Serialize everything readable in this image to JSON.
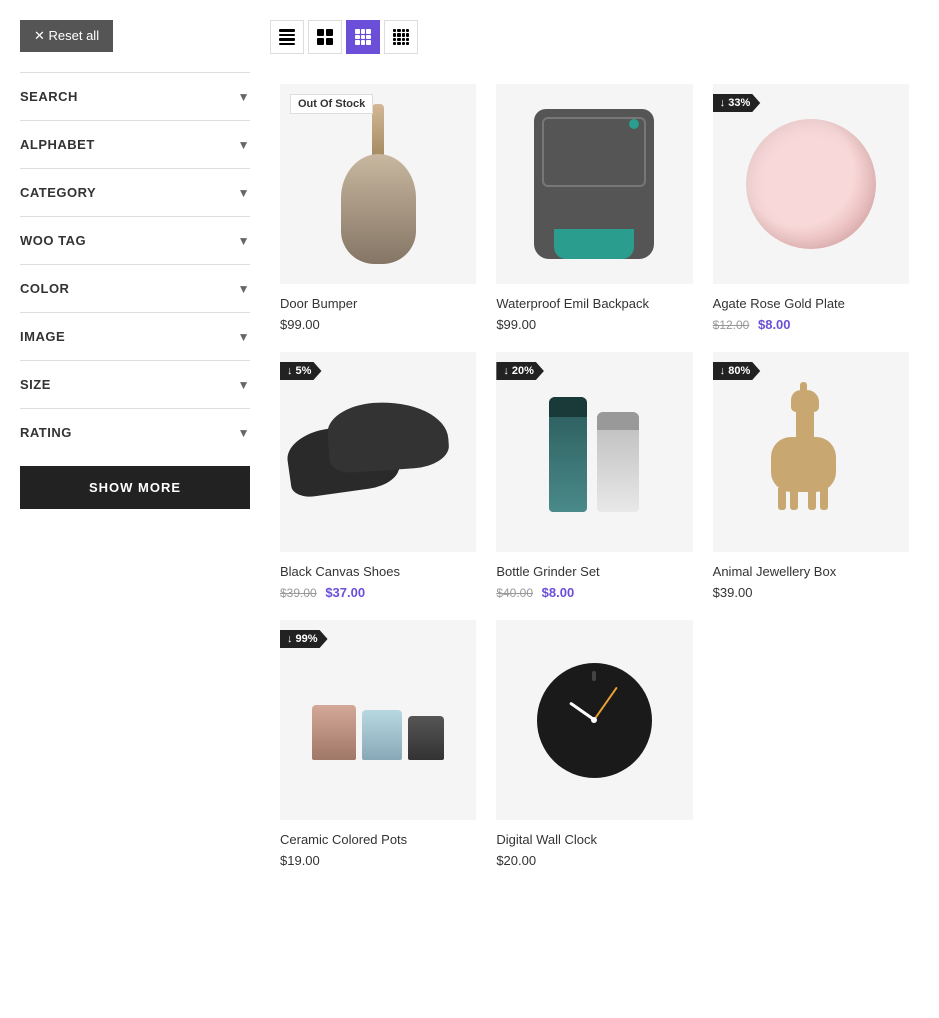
{
  "reset_button": "✕ Reset all",
  "filters": [
    {
      "id": "search",
      "label": "SEARCH"
    },
    {
      "id": "alphabet",
      "label": "ALPHABET"
    },
    {
      "id": "category",
      "label": "CATEGORY"
    },
    {
      "id": "woo-tag",
      "label": "WOO TAG"
    },
    {
      "id": "color",
      "label": "COLOR"
    },
    {
      "id": "image",
      "label": "IMAGE"
    },
    {
      "id": "size",
      "label": "SIZE"
    },
    {
      "id": "rating",
      "label": "RATING"
    }
  ],
  "show_more": "SHOW MORE",
  "products": [
    {
      "id": "door-bumper",
      "name": "Door Bumper",
      "price": "$99.00",
      "original_price": null,
      "sale_price": null,
      "badge_type": "out",
      "badge_text": "Out Of Stock",
      "type": "door-bumper"
    },
    {
      "id": "waterproof-backpack",
      "name": "Waterproof Emil Backpack",
      "price": "$99.00",
      "original_price": null,
      "sale_price": null,
      "badge_type": null,
      "badge_text": null,
      "type": "backpack"
    },
    {
      "id": "agate-plate",
      "name": "Agate Rose Gold Plate",
      "price": null,
      "original_price": "$12.00",
      "sale_price": "$8.00",
      "badge_type": "discount",
      "badge_text": "↓ 33%",
      "type": "plate"
    },
    {
      "id": "black-shoes",
      "name": "Black Canvas Shoes",
      "price": null,
      "original_price": "$39.00",
      "sale_price": "$37.00",
      "badge_type": "discount",
      "badge_text": "↓ 5%",
      "type": "shoes"
    },
    {
      "id": "bottle-grinder",
      "name": "Bottle Grinder Set",
      "price": null,
      "original_price": "$40.00",
      "sale_price": "$8.00",
      "badge_type": "discount",
      "badge_text": "↓ 20%",
      "type": "grinder"
    },
    {
      "id": "animal-jewellery",
      "name": "Animal Jewellery Box",
      "price": "$39.00",
      "original_price": null,
      "sale_price": null,
      "badge_type": "discount",
      "badge_text": "↓ 80%",
      "type": "llama"
    },
    {
      "id": "ceramic-pots",
      "name": "Ceramic Colored Pots",
      "price": "$19.00",
      "original_price": null,
      "sale_price": null,
      "badge_type": "discount",
      "badge_text": "↓ 99%",
      "type": "pots"
    },
    {
      "id": "digital-clock",
      "name": "Digital Wall Clock",
      "price": "$20.00",
      "original_price": null,
      "sale_price": null,
      "badge_type": null,
      "badge_text": null,
      "type": "clock"
    }
  ]
}
